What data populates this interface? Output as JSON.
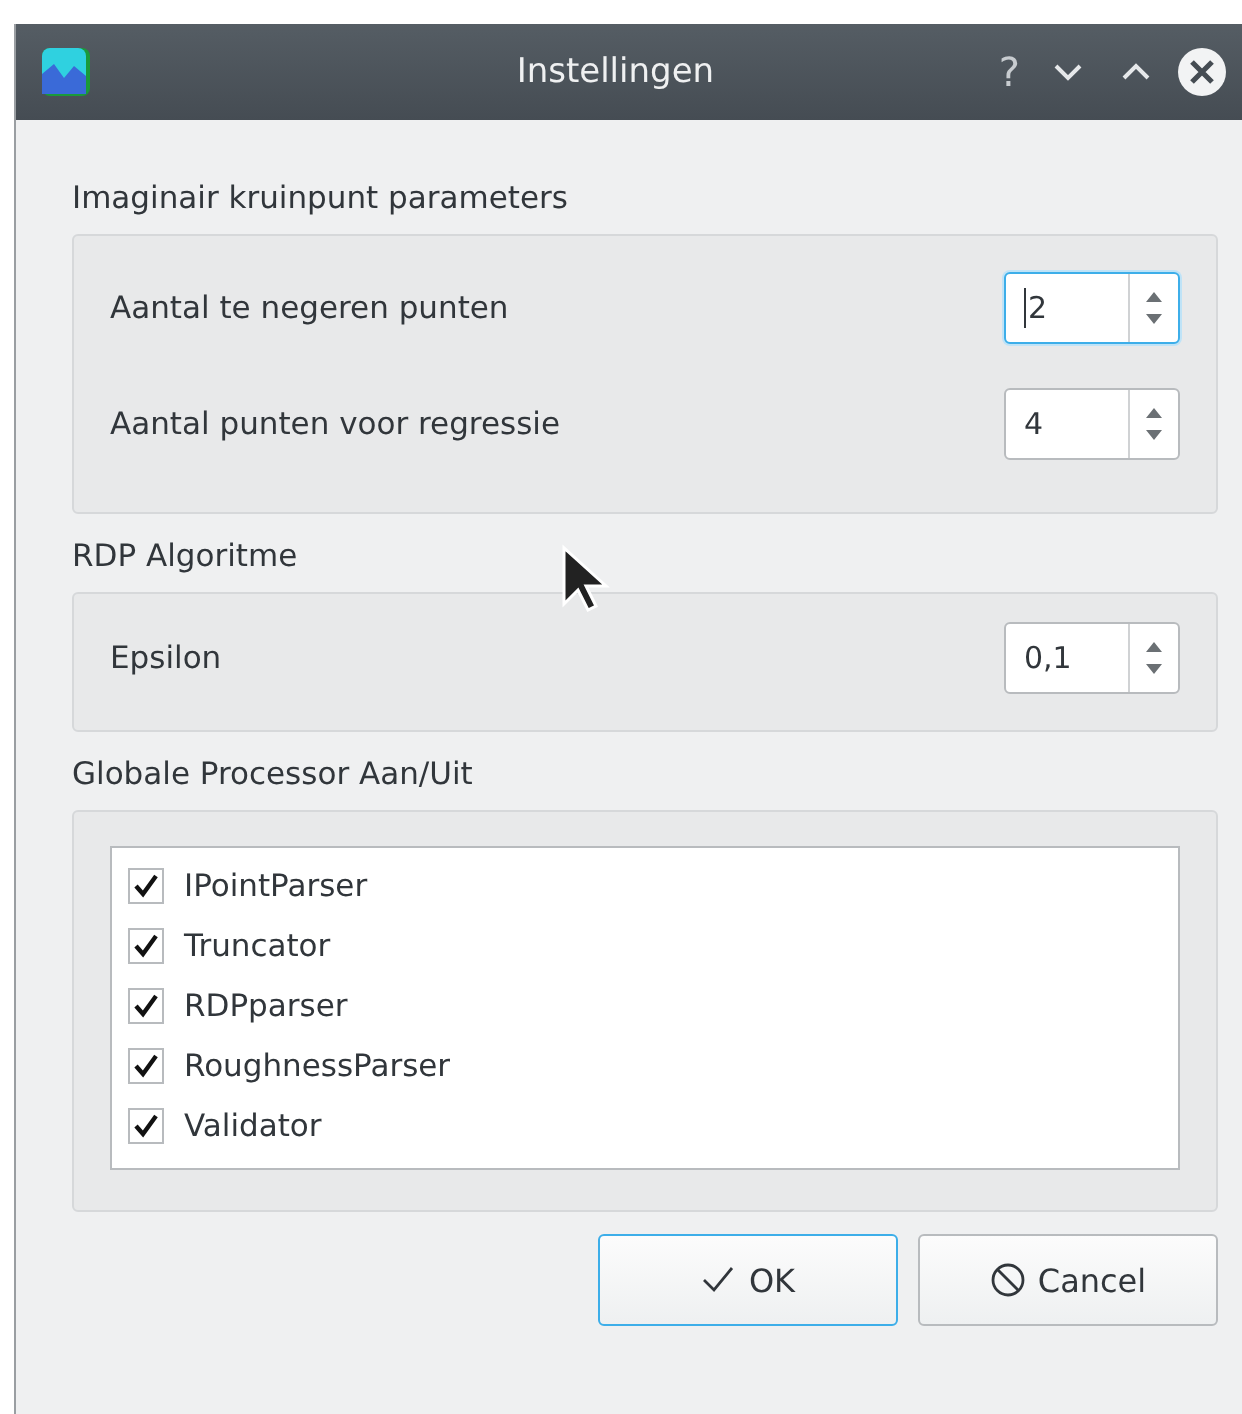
{
  "window": {
    "title": "Instellingen",
    "controls": [
      "?"
    ]
  },
  "groups": [
    {
      "title": "Imaginair kruinpunt parameters",
      "fields": [
        {
          "label": "Aantal te negeren punten",
          "value": "2",
          "focused": true
        },
        {
          "label": "Aantal punten voor regressie",
          "value": "4",
          "focused": false
        }
      ]
    },
    {
      "title": "RDP Algoritme",
      "fields": [
        {
          "label": "Epsilon",
          "value": "0,1",
          "focused": false
        }
      ]
    }
  ],
  "processors": {
    "title": "Globale Processor Aan/Uit",
    "items": [
      {
        "label": "IPointParser",
        "checked": true
      },
      {
        "label": "Truncator",
        "checked": true
      },
      {
        "label": "RDPparser",
        "checked": true
      },
      {
        "label": "RoughnessParser",
        "checked": true
      },
      {
        "label": "Validator",
        "checked": true
      }
    ]
  },
  "buttons": [
    {
      "label": "OK",
      "kind": "ok",
      "selected": true
    },
    {
      "label": "Cancel",
      "kind": "cancel",
      "selected": false
    }
  ]
}
